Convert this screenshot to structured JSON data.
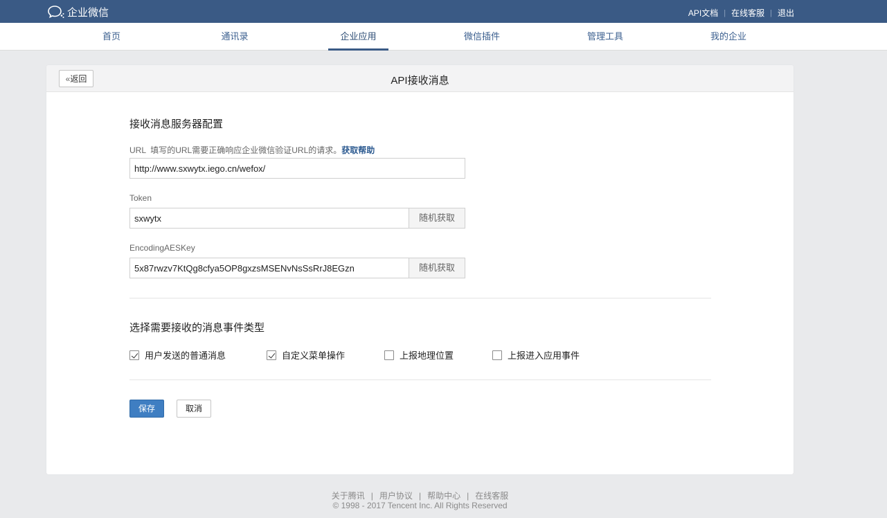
{
  "header": {
    "logo_text": "企业微信",
    "links": {
      "api_docs": "API文档",
      "online_service": "在线客服",
      "logout": "退出"
    }
  },
  "nav": {
    "items": [
      {
        "label": "首页"
      },
      {
        "label": "通讯录"
      },
      {
        "label": "企业应用",
        "active": true
      },
      {
        "label": "微信插件"
      },
      {
        "label": "管理工具"
      },
      {
        "label": "我的企业"
      }
    ]
  },
  "panel": {
    "back_label": "返回",
    "title": "API接收消息"
  },
  "server_config": {
    "title": "接收消息服务器配置",
    "url": {
      "label": "URL  填写的URL需要正确响应企业微信验证URL的请求。",
      "help_link": "获取帮助",
      "value": "http://www.sxwytx.iego.cn/wefox/"
    },
    "token": {
      "label": "Token",
      "value": "sxwytx",
      "random_button": "随机获取"
    },
    "aes_key": {
      "label": "EncodingAESKey",
      "value": "5x87rwzv7KtQg8cfya5OP8gxzsMSENvNsSsRrJ8EGzn",
      "random_button": "随机获取"
    }
  },
  "event_types": {
    "title": "选择需要接收的消息事件类型",
    "options": [
      {
        "label": "用户发送的普通消息",
        "checked": true
      },
      {
        "label": "自定义菜单操作",
        "checked": true
      },
      {
        "label": "上报地理位置",
        "checked": false
      },
      {
        "label": "上报进入应用事件",
        "checked": false
      }
    ]
  },
  "actions": {
    "save": "保存",
    "cancel": "取消"
  },
  "footer": {
    "links": [
      "关于腾讯",
      "用户协议",
      "帮助中心",
      "在线客服"
    ],
    "copyright": "© 1998 - 2017 Tencent Inc. All Rights Reserved"
  },
  "colors": {
    "topbar": "#3a5a85",
    "primary_button": "#3f7ec2",
    "link": "#2c5a90"
  }
}
